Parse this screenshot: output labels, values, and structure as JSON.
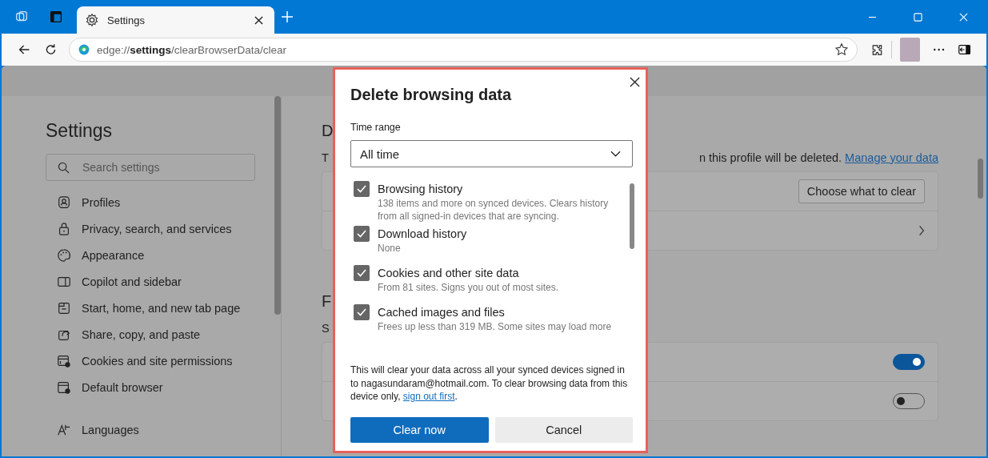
{
  "browser": {
    "tab": {
      "title": "Settings"
    },
    "address": "edge://**settings**/clearBrowserData/clear"
  },
  "sidebar": {
    "title": "Settings",
    "search": {
      "placeholder": "Search settings"
    },
    "items": [
      {
        "label": "Profiles"
      },
      {
        "label": "Privacy, search, and services"
      },
      {
        "label": "Appearance"
      },
      {
        "label": "Copilot and sidebar"
      },
      {
        "label": "Start, home, and new tab page"
      },
      {
        "label": "Share, copy, and paste"
      },
      {
        "label": "Cookies and site permissions"
      },
      {
        "label": "Default browser"
      },
      {
        "label": "Languages"
      }
    ]
  },
  "main": {
    "section_1": {
      "heading": "D",
      "description_start": "T",
      "description_end": "n this profile will be deleted.",
      "link": "Manage your data",
      "button": "Choose what to clear"
    },
    "section_2": {
      "heading": "F",
      "description_start": "S",
      "toggles": [
        {
          "on": true
        },
        {
          "on": false
        }
      ]
    }
  },
  "dialog": {
    "title": "Delete browsing data",
    "time_range": {
      "label": "Time range",
      "value": "All time"
    },
    "options": [
      {
        "label": "Browsing history",
        "description": "138 items and more on synced devices. Clears history from all signed-in devices that are syncing.",
        "checked": true
      },
      {
        "label": "Download history",
        "description": "None",
        "checked": true
      },
      {
        "label": "Cookies and other site data",
        "description": "From 81 sites. Signs you out of most sites.",
        "checked": true
      },
      {
        "label": "Cached images and files",
        "description": "Frees up less than 319 MB. Some sites may load more",
        "checked": true
      }
    ],
    "notice": "This will clear your data across all your synced devices signed in to nagasundaram@hotmail.com. To clear browsing data from this device only,",
    "notice_link": "sign out first",
    "notice_end": ".",
    "buttons": {
      "primary": "Clear now",
      "secondary": "Cancel"
    }
  }
}
